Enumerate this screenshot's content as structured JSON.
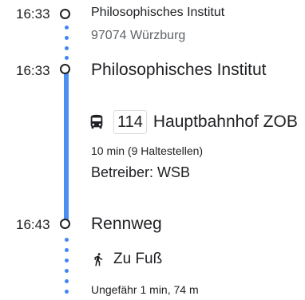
{
  "origin": {
    "time": "16:33",
    "name": "Philosophisches Institut",
    "address": "97074 Würzburg"
  },
  "board": {
    "time": "16:33",
    "name": "Philosophisches Institut"
  },
  "transit": {
    "icon": "bus-icon",
    "line": "114",
    "destination": "Hauptbahnhof ZOB",
    "duration": "10 min (9 Haltestellen)",
    "operator": "Betreiber: WSB",
    "color": "#4b8ff0"
  },
  "alight": {
    "time": "16:43",
    "name": "Rennweg"
  },
  "walk": {
    "icon": "walking-person-icon",
    "label": "Zu Fuß",
    "detail": "Ungefähr 1 min, 74 m",
    "dot_color": "#4285f4"
  }
}
